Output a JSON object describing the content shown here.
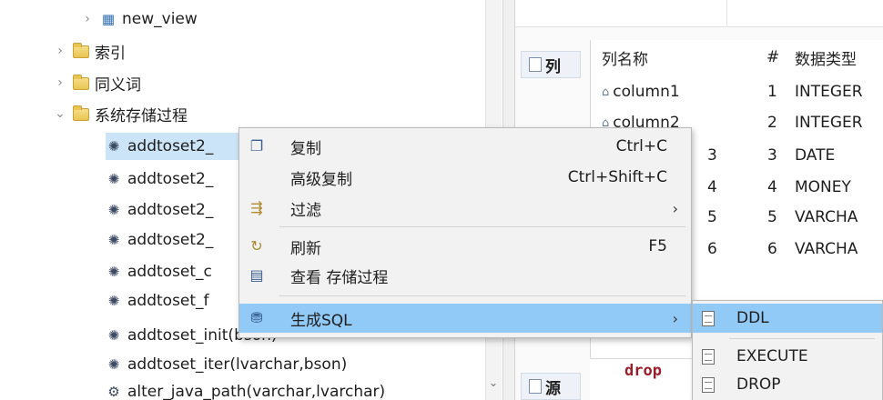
{
  "tree": {
    "items": [
      {
        "label": "new_view",
        "type": "view",
        "arrow": "›",
        "icon": "table-view-icon"
      },
      {
        "label": "索引",
        "type": "folder",
        "arrow": "›",
        "icon": "folder-icon"
      },
      {
        "label": "同义词",
        "type": "folder",
        "arrow": "›",
        "icon": "folder-icon"
      },
      {
        "label": "系统存储过程",
        "type": "folder",
        "arrow": "⌄",
        "icon": "folder-icon"
      },
      {
        "label": "addtoset2_",
        "type": "proc",
        "icon": "procedure-icon"
      },
      {
        "label": "addtoset2_",
        "type": "proc",
        "icon": "procedure-icon"
      },
      {
        "label": "addtoset2_",
        "type": "proc",
        "icon": "procedure-icon"
      },
      {
        "label": "addtoset2_",
        "type": "proc",
        "icon": "procedure-icon"
      },
      {
        "label": "addtoset_c",
        "type": "proc",
        "icon": "procedure-icon"
      },
      {
        "label": "addtoset_f",
        "type": "proc",
        "icon": "procedure-icon"
      },
      {
        "label": "addtoset_init(bson)",
        "type": "proc",
        "icon": "procedure-icon"
      },
      {
        "label": "addtoset_iter(lvarchar,bson)",
        "type": "proc",
        "icon": "procedure-icon"
      },
      {
        "label": "alter_java_path(varchar,lvarchar)",
        "type": "proc",
        "icon": "java-procedure-icon"
      }
    ]
  },
  "right_panel": {
    "columns_tab_label": "列",
    "source_tab_label": "源",
    "grid": {
      "headers": [
        "列名称",
        "#",
        "数据类型"
      ],
      "rows": [
        {
          "name": "column1",
          "num": "1",
          "type": "INTEGER"
        },
        {
          "name": "column2",
          "num": "2",
          "type": "INTEGER"
        },
        {
          "name": "3",
          "num": "3",
          "type": "DATE"
        },
        {
          "name": "4",
          "num": "4",
          "type": "MONEY"
        },
        {
          "name": "5",
          "num": "5",
          "type": "VARCHA"
        },
        {
          "name": "6",
          "num": "6",
          "type": "VARCHA"
        }
      ]
    },
    "source_keyword": "drop"
  },
  "context_menu": {
    "items": [
      {
        "label": "复制",
        "shortcut": "Ctrl+C",
        "icon": "copy-icon"
      },
      {
        "label": "高级复制",
        "shortcut": "Ctrl+Shift+C",
        "icon": ""
      },
      {
        "label": "过滤",
        "submenu": "›",
        "icon": "filter-icon"
      },
      {
        "label": "刷新",
        "shortcut": "F5",
        "icon": "refresh-icon"
      },
      {
        "label": "查看 存储过程",
        "icon": "view-procedure-icon"
      },
      {
        "label": "生成SQL",
        "submenu": "›",
        "icon": "generate-sql-icon",
        "highlighted": true
      }
    ]
  },
  "submenu": {
    "items": [
      {
        "label": "DDL",
        "highlighted": true,
        "icon": "document-icon"
      },
      {
        "label": "EXECUTE",
        "icon": "document-icon"
      },
      {
        "label": "DROP",
        "icon": "document-icon"
      }
    ]
  },
  "colors": {
    "selection": "#cce4f7",
    "menu_highlight": "#91c9f7",
    "keyword": "#9b1d2a"
  }
}
